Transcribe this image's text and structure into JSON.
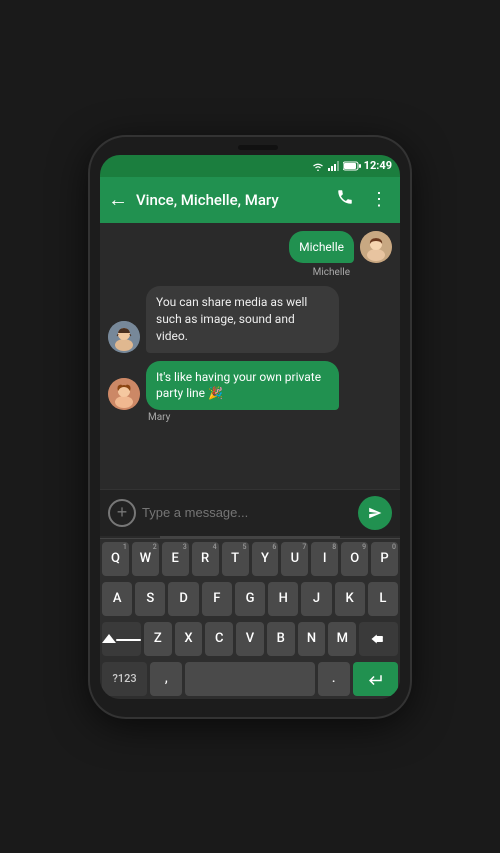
{
  "statusBar": {
    "time": "12:49"
  },
  "appBar": {
    "backLabel": "←",
    "title": "Vince, Michelle, Mary",
    "callIcon": "📞",
    "moreIcon": "⋮"
  },
  "chat": {
    "partialMessage": "Michelle",
    "messages": [
      {
        "id": "msg1",
        "sender": "vince",
        "senderName": "",
        "text": "You can share media as well such as image, sound and video.",
        "direction": "incoming"
      },
      {
        "id": "msg2",
        "sender": "mary",
        "senderName": "Mary",
        "text": "It's like having your own private party line 🎉",
        "direction": "outgoing_green"
      }
    ]
  },
  "inputArea": {
    "placeholder": "Type a message...",
    "addIcon": "+",
    "sendIcon": "▶"
  },
  "keyboard": {
    "row1": [
      "Q",
      "W",
      "E",
      "R",
      "T",
      "Y",
      "U",
      "I",
      "O",
      "P"
    ],
    "row1nums": [
      "1",
      "2",
      "3",
      "4",
      "5",
      "6",
      "7",
      "8",
      "9",
      "0"
    ],
    "row2": [
      "A",
      "S",
      "D",
      "F",
      "G",
      "H",
      "J",
      "K",
      "L"
    ],
    "row3": [
      "Z",
      "X",
      "C",
      "V",
      "B",
      "N",
      "M"
    ],
    "specialLeft": "?123",
    "comma": ",",
    "space": "",
    "period": ".",
    "enterIcon": "↵"
  }
}
